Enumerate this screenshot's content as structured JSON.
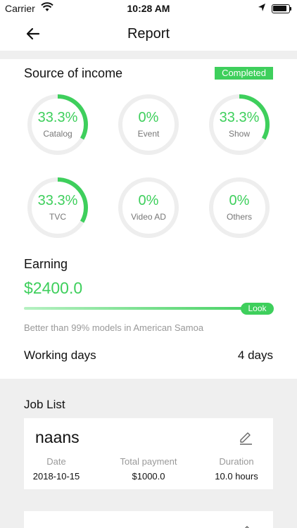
{
  "status_bar": {
    "carrier": "Carrier",
    "time": "10:28 AM"
  },
  "nav": {
    "title": "Report"
  },
  "income": {
    "title": "Source of income",
    "badge": "Completed",
    "items": [
      {
        "label": "Catalog",
        "percent": "33.3%",
        "fraction": 0.333
      },
      {
        "label": "Event",
        "percent": "0%",
        "fraction": 0
      },
      {
        "label": "Show",
        "percent": "33.3%",
        "fraction": 0.333
      },
      {
        "label": "TVC",
        "percent": "33.3%",
        "fraction": 0.333
      },
      {
        "label": "Video AD",
        "percent": "0%",
        "fraction": 0
      },
      {
        "label": "Others",
        "percent": "0%",
        "fraction": 0
      }
    ]
  },
  "earning": {
    "title": "Earning",
    "value": "$2400.0",
    "progress": 0.99,
    "look_label": "Look",
    "compare": "Better than 99% models in American Samoa"
  },
  "working_days": {
    "label": "Working days",
    "value": "4 days"
  },
  "job_list": {
    "title": "Job List",
    "jobs": [
      {
        "name": "naans",
        "date_label": "Date",
        "date": "2018-10-15",
        "payment_label": "Total payment",
        "payment": "$1000.0",
        "duration_label": "Duration",
        "duration": "10.0 hours"
      }
    ]
  },
  "colors": {
    "accent": "#3ecf5c",
    "track": "#eeeeee",
    "background": "#efefef"
  }
}
